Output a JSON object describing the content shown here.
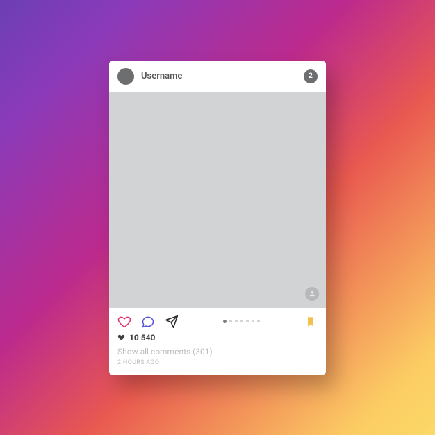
{
  "header": {
    "username": "Username",
    "badge_count": "2"
  },
  "carousel": {
    "total": 7,
    "active_index": 0
  },
  "likes": {
    "count": "10 540"
  },
  "comments": {
    "label": "Show all comments (301)"
  },
  "timestamp": "2 HOURS AGO",
  "colors": {
    "heart_outline": "#e1306c",
    "comment_outline": "#5851db",
    "share_outline": "#262626",
    "bookmark_fill": "#f2c14b"
  }
}
